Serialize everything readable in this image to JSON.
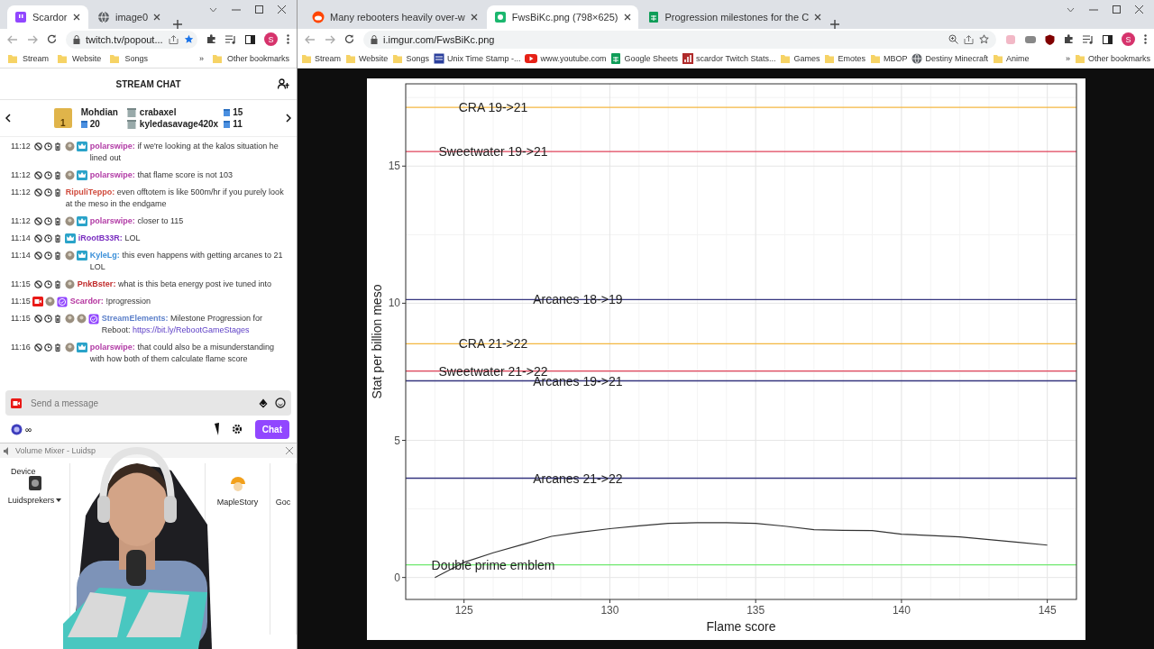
{
  "left_window": {
    "tabs": [
      {
        "title": "Scardor",
        "selected": true
      },
      {
        "title": "image0",
        "selected": false
      }
    ],
    "address": "twitch.tv/popout...",
    "profile_initial": "S",
    "bookmarks": [
      {
        "label": "Stream",
        "kind": "folder"
      },
      {
        "label": "Website",
        "kind": "folder"
      },
      {
        "label": "Songs",
        "kind": "folder"
      }
    ],
    "bookmarks_overflow": "»",
    "other_bookmarks": "Other bookmarks",
    "chat": {
      "title": "STREAM CHAT",
      "leaderboard": {
        "rank": "1",
        "top": {
          "name": "Mohdian",
          "count": "20"
        },
        "others": [
          {
            "name": "crabaxel",
            "count": "15"
          },
          {
            "name": "kyledasavage420x",
            "count": "11"
          }
        ]
      },
      "messages": [
        {
          "time": "11:12",
          "mod_actions": true,
          "kind": "subscriber",
          "user": "polarswipe:",
          "color": "#b23ca6",
          "text": "if we're looking at the kalos situation he lined out"
        },
        {
          "time": "11:12",
          "mod_actions": true,
          "kind": "subscriber",
          "user": "polarswipe:",
          "color": "#b23ca6",
          "text": "that flame score is not 103"
        },
        {
          "time": "11:12",
          "mod_actions": true,
          "kind": "plain",
          "user": "RipuliTeppo:",
          "color": "#d04a3c",
          "text": "even offtotem is like 500m/hr if you purely look at the meso in the endgame"
        },
        {
          "time": "11:12",
          "mod_actions": true,
          "kind": "subscriber",
          "user": "polarswipe:",
          "color": "#b23ca6",
          "text": "closer to 115"
        },
        {
          "time": "11:14",
          "mod_actions": true,
          "kind": "crown",
          "user": "iRootB33R:",
          "color": "#7a2fc0",
          "text": "LOL"
        },
        {
          "time": "11:14",
          "mod_actions": true,
          "kind": "subscriber",
          "user": "KyleLg:",
          "color": "#3a8fd9",
          "text": "this even happens with getting arcanes to 21 LOL"
        },
        {
          "time": "11:15",
          "mod_actions": true,
          "kind": "emote",
          "user": "PnkBster:",
          "color": "#c02a2a",
          "text": "what is this beta energy post ive tuned into"
        },
        {
          "time": "11:15",
          "mod_actions": false,
          "kind": "broadcaster",
          "user": "Scardor:",
          "color": "#b5359f",
          "text": "!progression"
        },
        {
          "time": "11:15",
          "mod_actions": true,
          "kind": "bot",
          "user": "StreamElements:",
          "color": "#5b7fc9",
          "text": "Milestone Progression for Reboot:",
          "link": "https://bit.ly/RebootGameStages"
        },
        {
          "time": "11:16",
          "mod_actions": true,
          "kind": "subscriber",
          "user": "polarswipe:",
          "color": "#b23ca6",
          "text": "that could also be a misunderstanding with how both of them calculate flame score"
        }
      ],
      "input": {
        "placeholder": "Send a message"
      },
      "points": "∞",
      "chat_button": "Chat"
    }
  },
  "volume_mixer": {
    "title": "Volume Mixer - Luidsp",
    "device_label": "Device",
    "device": "Luidsprekers",
    "apps": [
      "MapleStory",
      "Goc"
    ]
  },
  "right_window": {
    "tabs": [
      {
        "title": "Many rebooters heavily over-w",
        "selected": false
      },
      {
        "title": "FwsBiKc.png (798×625)",
        "selected": true
      },
      {
        "title": "Progression milestones for the C",
        "selected": false
      }
    ],
    "address": "i.imgur.com/FwsBiKc.png",
    "profile_initial": "S",
    "bookmarks": [
      {
        "label": "Stream",
        "kind": "folder"
      },
      {
        "label": "Website",
        "kind": "folder"
      },
      {
        "label": "Songs",
        "kind": "folder"
      },
      {
        "label": "Unix Time Stamp -...",
        "kind": "site"
      },
      {
        "label": "www.youtube.com",
        "kind": "video"
      },
      {
        "label": "Google Sheets",
        "kind": "sheets"
      },
      {
        "label": "scardor Twitch Stats...",
        "kind": "stats"
      },
      {
        "label": "Games",
        "kind": "folder"
      },
      {
        "label": "Emotes",
        "kind": "folder"
      },
      {
        "label": "MBOP",
        "kind": "folder"
      },
      {
        "label": "Destiny Minecraft",
        "kind": "globe"
      },
      {
        "label": "Anime",
        "kind": "folder"
      }
    ],
    "bookmarks_overflow": "»",
    "other_bookmarks": "Other bookmarks",
    "chart_data": {
      "type": "line",
      "xlabel": "Flame score",
      "ylabel": "Stat per billion meso",
      "grid": true,
      "x": [
        123,
        124,
        125,
        126,
        127,
        128,
        129,
        130,
        131,
        132,
        133,
        134,
        135,
        136,
        137,
        138,
        139,
        140,
        141,
        142,
        143,
        144,
        145,
        146
      ],
      "series": [
        {
          "name": "CRA 19->21",
          "color": "#f4b740",
          "values": [
            17.14,
            17.14,
            17.14,
            17.14,
            17.14,
            17.14,
            17.14,
            17.14,
            17.14,
            17.14,
            17.14,
            17.14,
            17.14,
            17.14,
            17.14,
            17.14,
            17.14,
            17.14,
            17.14,
            17.14,
            17.14,
            17.14,
            17.14,
            17.14
          ]
        },
        {
          "name": "Sweetwater 19->21",
          "color": "#e0435a",
          "values": [
            15.53,
            15.53,
            15.53,
            15.53,
            15.53,
            15.53,
            15.53,
            15.53,
            15.53,
            15.53,
            15.53,
            15.53,
            15.53,
            15.53,
            15.53,
            15.53,
            15.53,
            15.53,
            15.53,
            15.53,
            15.53,
            15.53,
            15.53,
            15.53
          ]
        },
        {
          "name": "Arcanes 18->19",
          "color": "#35357f",
          "values": [
            10.13,
            10.13,
            10.13,
            10.13,
            10.13,
            10.13,
            10.13,
            10.13,
            10.13,
            10.13,
            10.13,
            10.13,
            10.13,
            10.13,
            10.13,
            10.13,
            10.13,
            10.13,
            10.13,
            10.13,
            10.13,
            10.13,
            10.13,
            10.13
          ]
        },
        {
          "name": "CRA 21->22",
          "color": "#f4b740",
          "values": [
            8.52,
            8.52,
            8.52,
            8.52,
            8.52,
            8.52,
            8.52,
            8.52,
            8.52,
            8.52,
            8.52,
            8.52,
            8.52,
            8.52,
            8.52,
            8.52,
            8.52,
            8.52,
            8.52,
            8.52,
            8.52,
            8.52,
            8.52,
            8.52
          ]
        },
        {
          "name": "Sweetwater 21->22",
          "color": "#e0435a",
          "values": [
            7.53,
            7.53,
            7.53,
            7.53,
            7.53,
            7.53,
            7.53,
            7.53,
            7.53,
            7.53,
            7.53,
            7.53,
            7.53,
            7.53,
            7.53,
            7.53,
            7.53,
            7.53,
            7.53,
            7.53,
            7.53,
            7.53,
            7.53,
            7.53
          ]
        },
        {
          "name": "Arcanes 19->21",
          "color": "#35357f",
          "values": [
            7.17,
            7.17,
            7.17,
            7.17,
            7.17,
            7.17,
            7.17,
            7.17,
            7.17,
            7.17,
            7.17,
            7.17,
            7.17,
            7.17,
            7.17,
            7.17,
            7.17,
            7.17,
            7.17,
            7.17,
            7.17,
            7.17,
            7.17,
            7.17
          ]
        },
        {
          "name": "Arcanes 21->22",
          "color": "#35357f",
          "values": [
            3.62,
            3.62,
            3.62,
            3.62,
            3.62,
            3.62,
            3.62,
            3.62,
            3.62,
            3.62,
            3.62,
            3.62,
            3.62,
            3.62,
            3.62,
            3.62,
            3.62,
            3.62,
            3.62,
            3.62,
            3.62,
            3.62,
            3.62,
            3.62
          ]
        },
        {
          "name": "Double prime emblem",
          "color": "#6ee86e",
          "values": [
            0.46,
            0.46,
            0.46,
            0.46,
            0.46,
            0.46,
            0.46,
            0.46,
            0.46,
            0.46,
            0.46,
            0.46,
            0.46,
            0.46,
            0.46,
            0.46,
            0.46,
            0.46,
            0.46,
            0.46,
            0.46,
            0.46,
            0.46,
            0.46
          ]
        },
        {
          "color": "#333333",
          "values": [
            null,
            0.0,
            0.55,
            0.9,
            1.2,
            1.5,
            1.65,
            1.78,
            1.88,
            1.97,
            2.0,
            2.0,
            1.97,
            1.87,
            1.74,
            1.72,
            1.71,
            1.58,
            1.53,
            1.48,
            1.38,
            1.28,
            1.18,
            null
          ]
        }
      ],
      "xlim": [
        123,
        146
      ],
      "ylim": [
        -0.8,
        18
      ],
      "xticks": [
        125,
        130,
        135,
        140,
        145
      ],
      "yticks": [
        0,
        5,
        10,
        15
      ]
    }
  }
}
